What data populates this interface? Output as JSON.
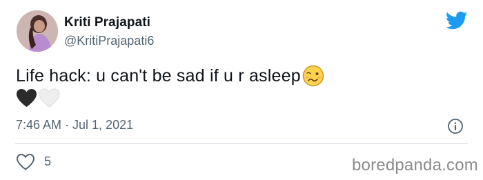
{
  "author": {
    "display_name": "Kriti Prajapati",
    "handle": "@KritiPrajapati6"
  },
  "tweet": {
    "text": "Life hack: u can't be sad if u r asleep",
    "emoji": "woozy-face",
    "hearts": [
      "black-heart",
      "white-heart"
    ],
    "timestamp": "7:46 AM · Jul 1, 2021"
  },
  "actions": {
    "like_count": "5"
  },
  "icons": {
    "brand": "twitter-bird-icon",
    "info": "info-icon",
    "like": "heart-outline-icon"
  },
  "colors": {
    "brand": "#1d9bf0",
    "secondary_text": "#536471",
    "divider": "#cfd9de"
  },
  "watermark": "boredpanda.com"
}
